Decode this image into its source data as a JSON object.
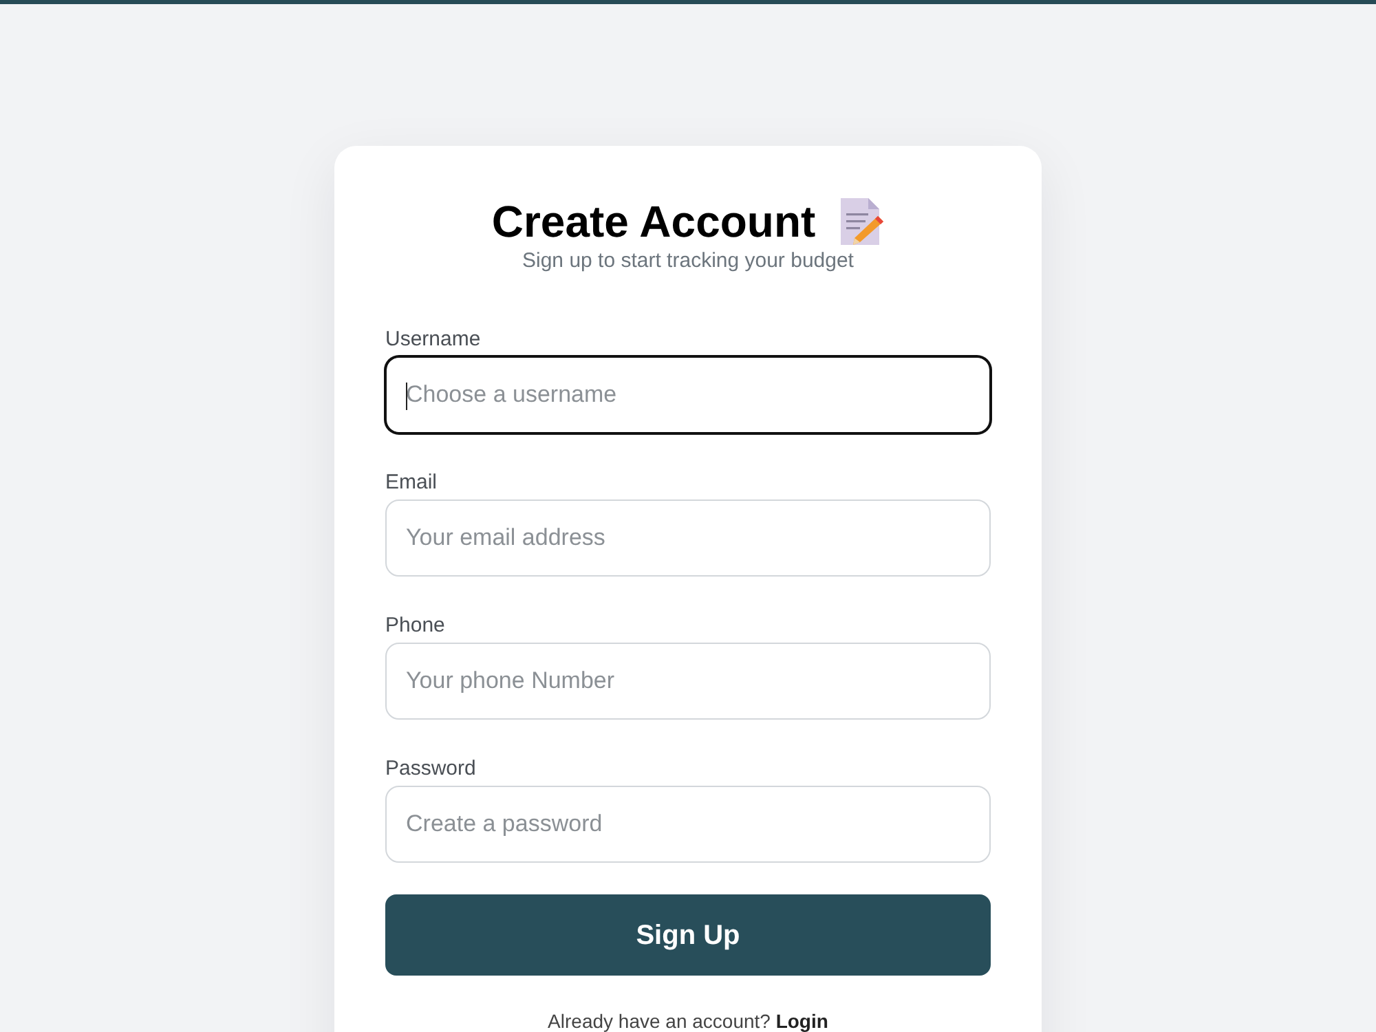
{
  "header": {
    "title": "Create Account",
    "subtitle": "Sign up to start tracking your budget"
  },
  "fields": [
    {
      "label": "Username",
      "placeholder": "Choose a username",
      "focused": true
    },
    {
      "label": "Email",
      "placeholder": "Your email address",
      "focused": false
    },
    {
      "label": "Phone",
      "placeholder": "Your phone Number",
      "focused": false
    },
    {
      "label": "Password",
      "placeholder": "Create a password",
      "focused": false
    }
  ],
  "submit_button": {
    "label": "Sign Up"
  },
  "footer": {
    "prompt": "Already have an account?",
    "link": "Login"
  }
}
